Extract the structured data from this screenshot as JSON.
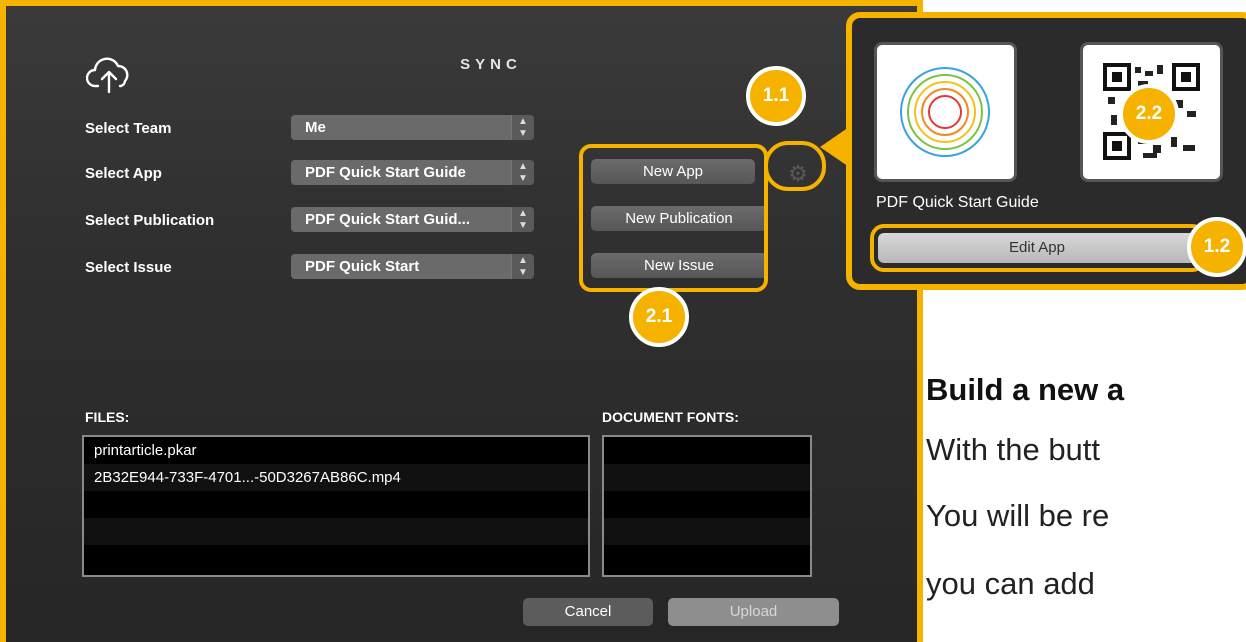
{
  "dialog": {
    "title": "SYNC",
    "fields": [
      {
        "label": "Select Team",
        "value": "Me"
      },
      {
        "label": "Select App",
        "value": "PDF Quick Start Guide"
      },
      {
        "label": "Select Publication",
        "value": "PDF Quick Start Guid..."
      },
      {
        "label": "Select Issue",
        "value": "PDF Quick Start"
      }
    ],
    "buttons": {
      "new_app": "New App",
      "new_publication": "New Publication",
      "new_issue": "New Issue",
      "cancel": "Cancel",
      "upload": "Upload"
    },
    "files_label": "FILES:",
    "files": [
      "printarticle.pkar",
      "2B32E944-733F-4701...-50D3267AB86C.mp4",
      "",
      "",
      ""
    ],
    "fonts_label": "DOCUMENT FONTS:",
    "fonts": [
      "",
      "",
      "",
      "",
      ""
    ],
    "icons": {
      "cloud": "cloud-upload-icon",
      "gear": "gear-icon",
      "arrows": "updown-arrows-icon"
    }
  },
  "badges": {
    "b11": "1.1",
    "b12": "1.2",
    "b21": "2.1",
    "b22": "2.2"
  },
  "popover": {
    "app_name": "PDF Quick Start Guide",
    "edit_button": "Edit App"
  },
  "article": {
    "heading": "Build a new a",
    "lines": [
      "With the butt",
      "You will be re",
      "you can add"
    ]
  },
  "colors": {
    "accent": "#f5b300",
    "dialog_bg": "#2f2f2f"
  }
}
